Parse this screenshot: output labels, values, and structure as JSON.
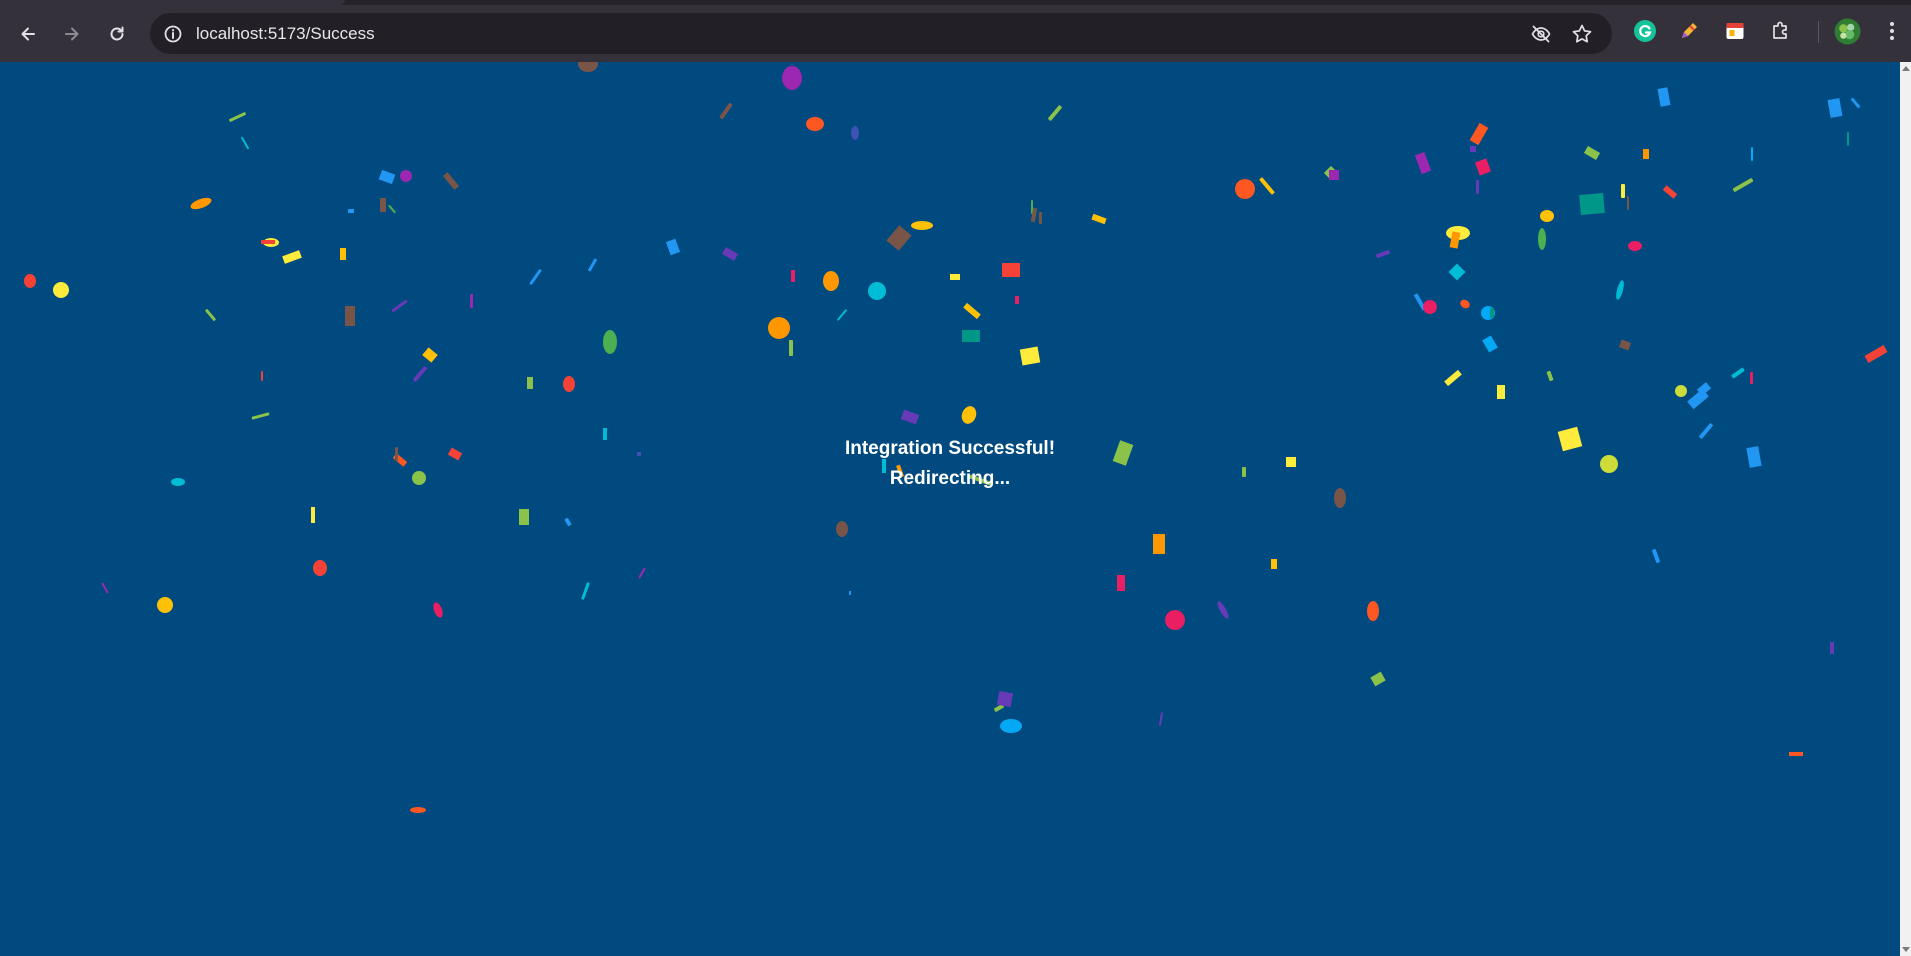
{
  "browser": {
    "url": "localhost:5173/Success",
    "buttons": [
      "back",
      "forward",
      "reload"
    ],
    "omnibox_icons": [
      "eye-slash-icon",
      "bookmark-star-icon"
    ],
    "extension_icons": [
      "grammarly-icon",
      "pen-extension-icon",
      "calendar-extension-icon",
      "extensions-puzzle-icon",
      "profile-avatar",
      "chrome-menu-icon"
    ]
  },
  "message": {
    "line1": "Integration Successful!",
    "line2": "Redirecting..."
  },
  "colors": {
    "page_background": "#004a7f",
    "text": "#ffffff",
    "confetti_palette": [
      "#f44336",
      "#e91e63",
      "#9c27b0",
      "#673ab7",
      "#3f51b5",
      "#2196f3",
      "#03a9f4",
      "#00bcd4",
      "#009688",
      "#4caf50",
      "#8bc34a",
      "#cddc39",
      "#ffeb3b",
      "#ffc107",
      "#ff9800",
      "#ff5722",
      "#795548"
    ]
  }
}
